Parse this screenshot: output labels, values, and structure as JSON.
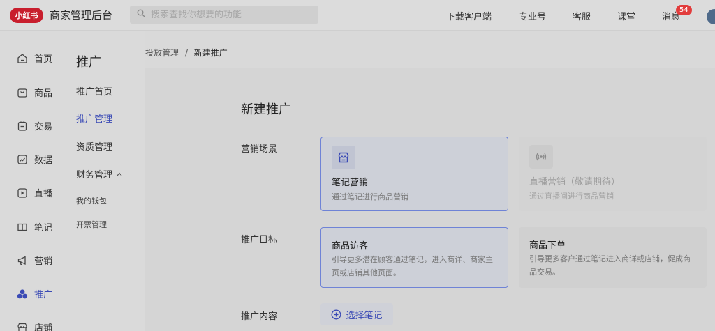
{
  "header": {
    "logo_text": "小红书",
    "app_title": "商家管理后台",
    "search_placeholder": "搜索查找你想要的功能",
    "nav": [
      "下载客户端",
      "专业号",
      "客服",
      "课堂"
    ],
    "messages_label": "消息",
    "messages_count": "54"
  },
  "sidebar": {
    "items": [
      {
        "label": "首页",
        "icon": "home-icon"
      },
      {
        "label": "商品",
        "icon": "bag-icon"
      },
      {
        "label": "交易",
        "icon": "order-icon"
      },
      {
        "label": "数据",
        "icon": "chart-icon"
      },
      {
        "label": "直播",
        "icon": "play-icon"
      },
      {
        "label": "笔记",
        "icon": "book-icon"
      },
      {
        "label": "营销",
        "icon": "megaphone-icon"
      },
      {
        "label": "推广",
        "icon": "promote-icon"
      },
      {
        "label": "店铺",
        "icon": "store-icon"
      }
    ],
    "active": "推广"
  },
  "subnav": {
    "title": "推广",
    "items": [
      "推广首页",
      "推广管理",
      "资质管理",
      "财务管理"
    ],
    "finance_children": [
      "我的钱包",
      "开票管理"
    ],
    "active": "推广管理"
  },
  "breadcrumb": {
    "parent": "投放管理",
    "separator": "/",
    "current": "新建推广"
  },
  "form": {
    "title": "新建推广",
    "scene_label": "营销场景",
    "goal_label": "推广目标",
    "content_label": "推广内容",
    "scene_options": [
      {
        "title": "笔记营销",
        "desc": "通过笔记进行商品营销",
        "selected": true,
        "disabled": false,
        "icon": "store-icon"
      },
      {
        "title": "直播营销（敬请期待）",
        "desc": "通过直播间进行商品营销",
        "selected": false,
        "disabled": true,
        "icon": "broadcast-icon"
      }
    ],
    "goal_options": [
      {
        "title": "商品访客",
        "desc": "引导更多潜在顾客通过笔记，进入商详、商家主页或店铺其他页面。",
        "selected": true
      },
      {
        "title": "商品下单",
        "desc": "引导更多客户通过笔记进入商详或店铺，促成商品交易。",
        "selected": false
      }
    ],
    "select_note_label": "选择笔记"
  },
  "colors": {
    "accent": "#3a4ab5",
    "brand_red": "#c81e2d",
    "badge_red": "#e23c3c",
    "overlay_gray": "#d9d9d9"
  }
}
